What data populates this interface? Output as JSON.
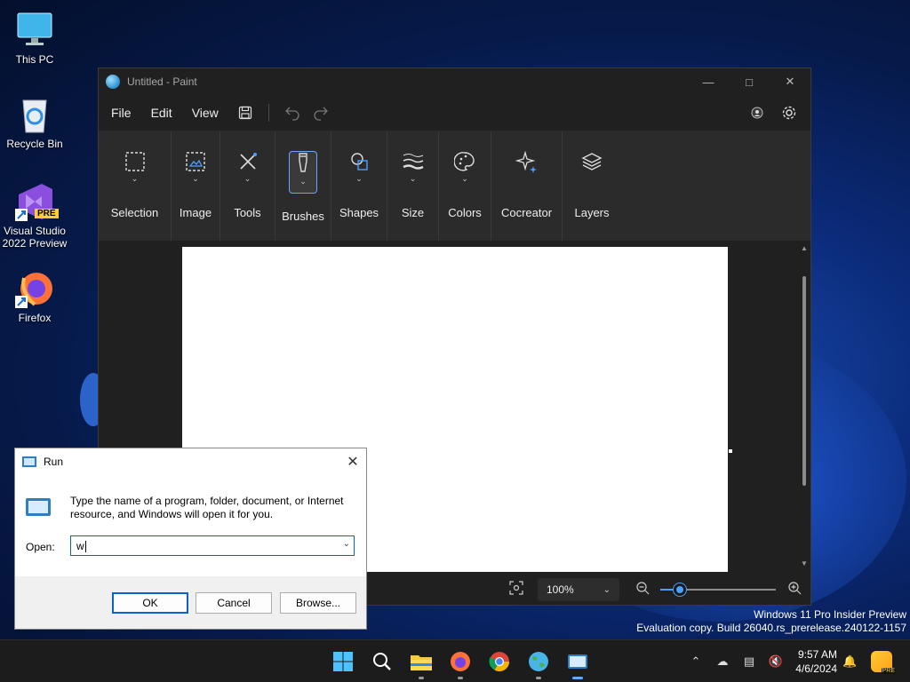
{
  "desktop": {
    "icons": [
      {
        "label": "This PC"
      },
      {
        "label": "Recycle Bin"
      },
      {
        "label": "Visual Studio 2022 Preview",
        "badge": "PRE"
      },
      {
        "label": "Firefox"
      }
    ],
    "watermark": {
      "line1": "Windows 11 Pro Insider Preview",
      "line2": "Evaluation copy. Build 26040.rs_prerelease.240122-1157"
    }
  },
  "paint": {
    "title": "Untitled - Paint",
    "menu": [
      "File",
      "Edit",
      "View"
    ],
    "ribbon": [
      {
        "label": "Selection",
        "icon": "selection-icon"
      },
      {
        "label": "Image",
        "icon": "image-icon"
      },
      {
        "label": "Tools",
        "icon": "tools-icon"
      },
      {
        "label": "Brushes",
        "icon": "brushes-icon",
        "active": true
      },
      {
        "label": "Shapes",
        "icon": "shapes-icon"
      },
      {
        "label": "Size",
        "icon": "size-icon"
      },
      {
        "label": "Colors",
        "icon": "colors-icon"
      },
      {
        "label": "Cocreator",
        "icon": "cocreator-icon"
      },
      {
        "label": "Layers",
        "icon": "layers-icon"
      }
    ],
    "zoom": "100%",
    "zoom_slider_fraction": 0.17
  },
  "run_dialog": {
    "title": "Run",
    "description": "Type the name of a program, folder, document, or Internet resource, and Windows will open it for you.",
    "open_label": "Open:",
    "open_value": "w",
    "ok_label": "OK",
    "cancel_label": "Cancel",
    "browse_label": "Browse..."
  },
  "taskbar": {
    "time": "9:57 AM",
    "date": "4/6/2024",
    "copilot_badge": "PRE",
    "apps": [
      "start-icon",
      "search-icon",
      "file-explorer-icon",
      "firefox-icon",
      "chrome-icon",
      "earth-icon",
      "run-icon"
    ]
  },
  "colors": {
    "accent": "#4c9fff",
    "paint_bg": "#202020",
    "ribbon_bg": "#2b2b2b"
  }
}
